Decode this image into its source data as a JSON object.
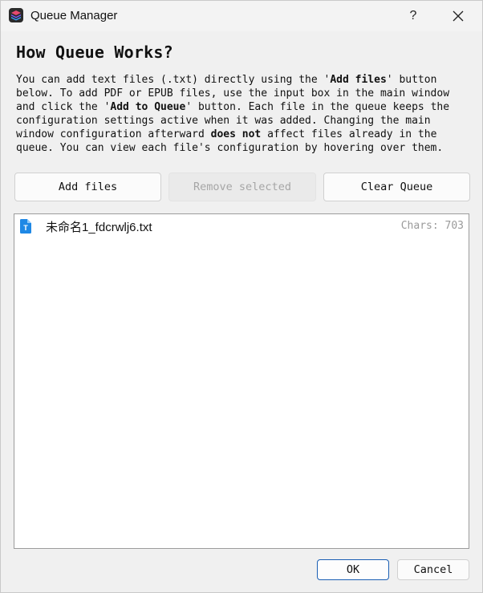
{
  "window": {
    "title": "Queue Manager",
    "help_label": "?",
    "app_icon": "stack-logo-icon",
    "close_icon": "close-icon"
  },
  "intro": {
    "heading": "How Queue Works?",
    "line1_a": "You can add text files (.txt) directly using the '",
    "line1_b": "Add files",
    "line1_c": "' button",
    "line2": "below. To add PDF or EPUB files, use the input box in the main window",
    "line3_a": "and click the '",
    "line3_b": "Add to Queue",
    "line3_c": "' button. Each file in the queue keeps the",
    "line4": "configuration settings active when it was added. Changing the main",
    "line5_a": "window configuration afterward ",
    "line5_b": "does not",
    "line5_c": " affect files already in the",
    "line6": "queue. You can view each file's configuration by hovering over them."
  },
  "toolbar": {
    "add_files": "Add files",
    "remove_selected": "Remove selected",
    "clear_queue": "Clear Queue"
  },
  "queue": {
    "items": [
      {
        "name": "未命名1_fdcrwlj6.txt",
        "chars": "Chars: 703",
        "icon": "text-file-icon"
      }
    ]
  },
  "footer": {
    "ok": "OK",
    "cancel": "Cancel"
  },
  "colors": {
    "accent": "#1a5fb4",
    "file_icon": "#1e88e5"
  }
}
